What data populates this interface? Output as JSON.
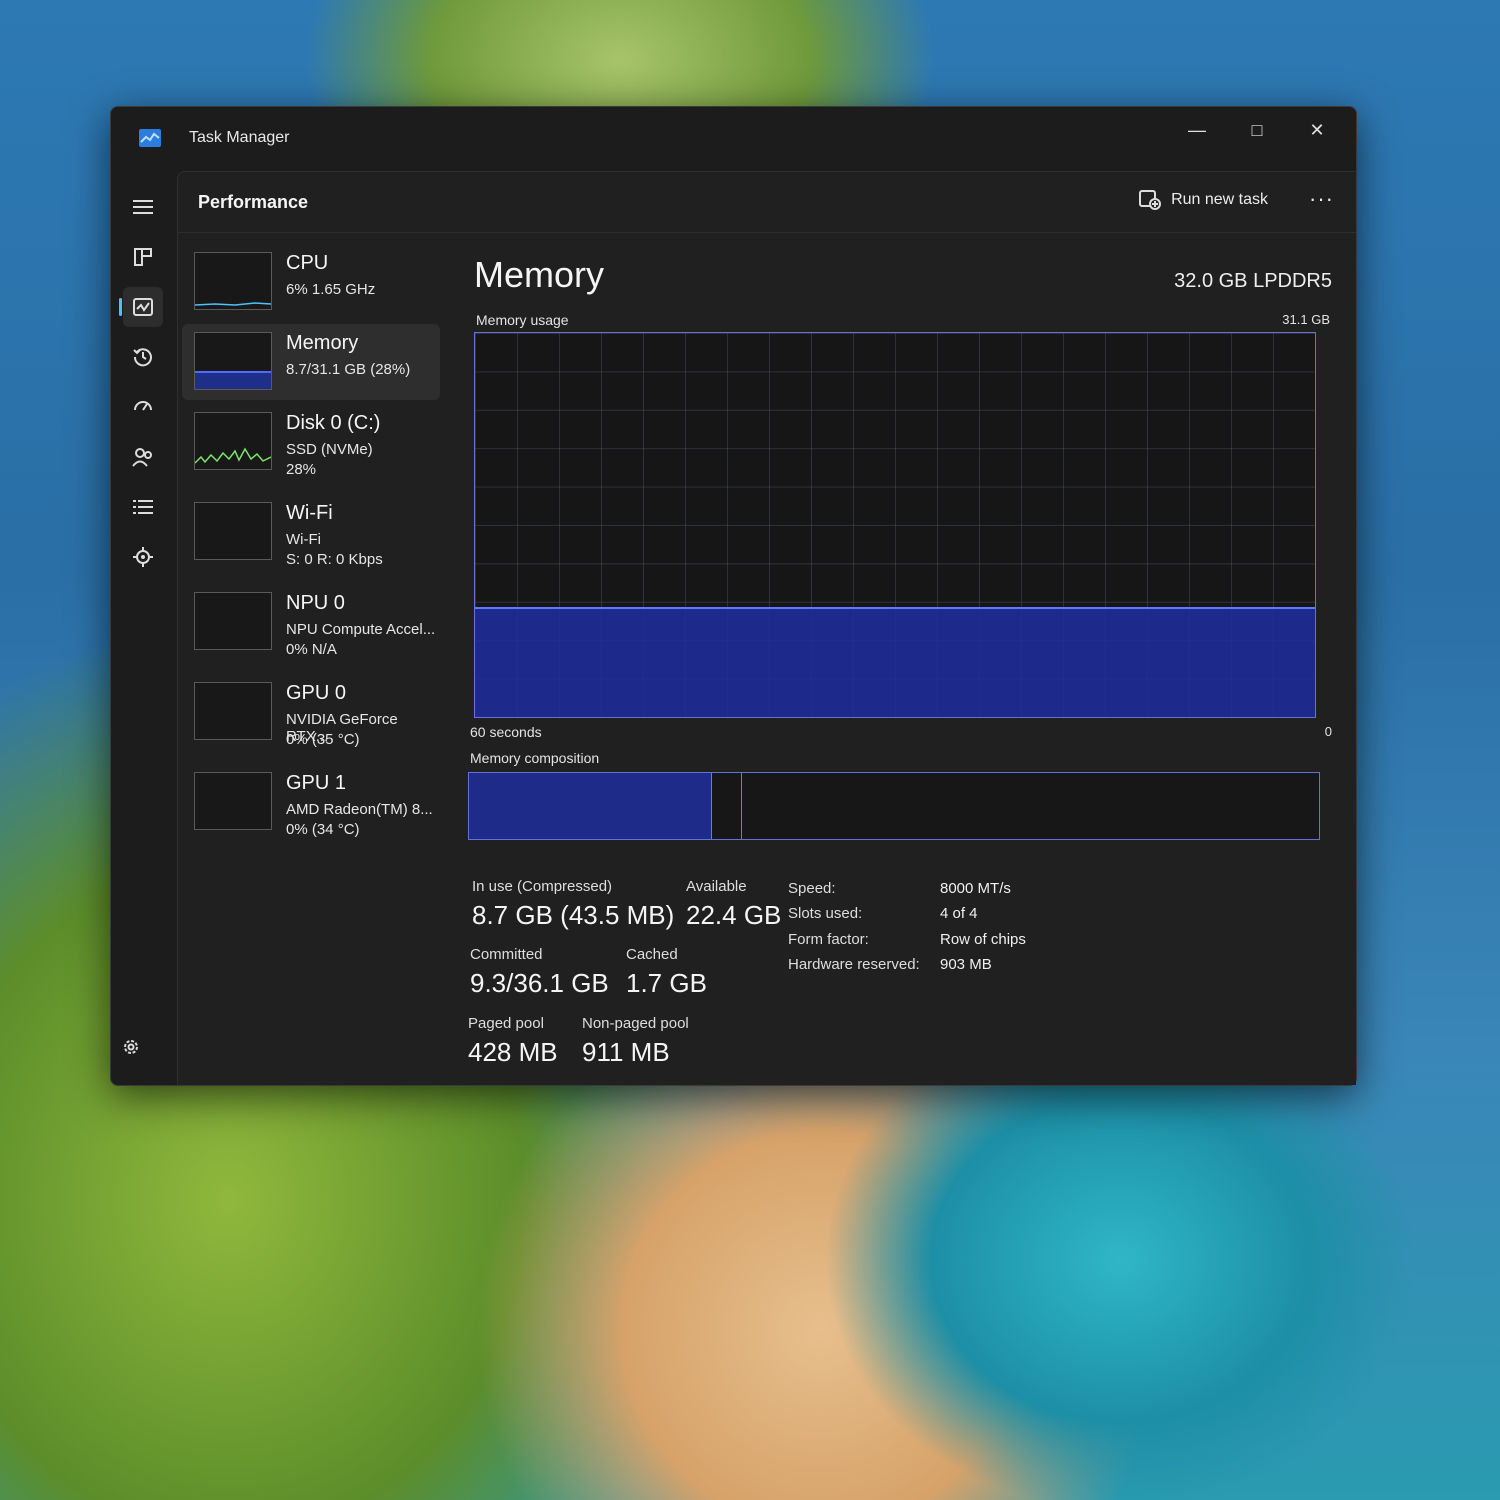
{
  "window": {
    "title": "Task Manager",
    "accent": "#4cc2ff",
    "graph_color": "#5e78ff"
  },
  "nav": {
    "items": [
      {
        "icon": "hamburger-menu-icon"
      },
      {
        "icon": "processes-icon"
      },
      {
        "icon": "performance-icon"
      },
      {
        "icon": "app-history-icon"
      },
      {
        "icon": "startup-apps-icon"
      },
      {
        "icon": "users-icon"
      },
      {
        "icon": "details-icon"
      },
      {
        "icon": "services-icon"
      }
    ],
    "active_index": 2,
    "settings_icon": "gear-icon"
  },
  "header": {
    "title": "Performance",
    "run_task_label": "Run new task",
    "more_label": "···"
  },
  "resources": [
    {
      "name": "CPU",
      "line1": "6%  1.65 GHz",
      "line2": ""
    },
    {
      "name": "Memory",
      "line1": "8.7/31.1 GB (28%)",
      "line2": ""
    },
    {
      "name": "Disk 0 (C:)",
      "line1": "SSD (NVMe)",
      "line2": "28%"
    },
    {
      "name": "Wi-Fi",
      "line1": "Wi-Fi",
      "line2": "S: 0  R: 0 Kbps"
    },
    {
      "name": "NPU 0",
      "line1": "NPU Compute Accel...",
      "line2": "0%  N/A"
    },
    {
      "name": "GPU 0",
      "line1": "NVIDIA GeForce RTX...",
      "line2": "0%  (35 °C)"
    },
    {
      "name": "GPU 1",
      "line1": "AMD Radeon(TM) 8...",
      "line2": "0%  (34 °C)"
    }
  ],
  "selected_resource_index": 1,
  "memory": {
    "title": "Memory",
    "spec": "32.0 GB LPDDR5",
    "usage_label": "Memory usage",
    "usage_max": "31.1 GB",
    "time_span": "60 seconds",
    "axis_min": "0",
    "usage_fraction": 0.28,
    "composition_label": "Memory composition",
    "composition": {
      "in_use_fraction": 0.28,
      "modified_fraction": 0.005,
      "standby_fraction": 0.035
    },
    "in_use_label": "In use (Compressed)",
    "in_use_value": "8.7 GB (43.5 MB)",
    "available_label": "Available",
    "available_value": "22.4 GB",
    "committed_label": "Committed",
    "committed_value": "9.3/36.1 GB",
    "cached_label": "Cached",
    "cached_value": "1.7 GB",
    "paged_label": "Paged pool",
    "paged_value": "428 MB",
    "nonpaged_label": "Non-paged pool",
    "nonpaged_value": "911 MB",
    "speed_label": "Speed:",
    "speed_value": "8000 MT/s",
    "slots_label": "Slots used:",
    "slots_value": "4 of 4",
    "form_label": "Form factor:",
    "form_value": "Row of chips",
    "hwres_label": "Hardware reserved:",
    "hwres_value": "903 MB"
  }
}
